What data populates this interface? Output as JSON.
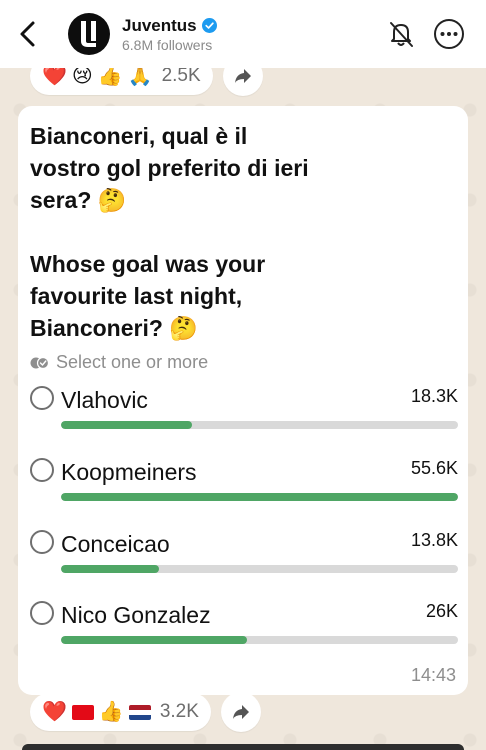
{
  "header": {
    "channel_name": "Juventus",
    "followers": "6.8M followers"
  },
  "reactions_top": {
    "emojis": [
      "❤️",
      "😢",
      "👍",
      "🙏"
    ],
    "count": "2.5K"
  },
  "poll": {
    "question": "Bianconeri, qual è il\nvostro gol preferito di ieri\nsera? 🤔\n\nWhose goal was your\nfavourite last night,\nBianconeri? 🤔",
    "select_hint": "Select one or more",
    "options": [
      {
        "label": "Vlahovic",
        "count": "18.3K",
        "fraction": 0.329
      },
      {
        "label": "Koopmeiners",
        "count": "55.6K",
        "fraction": 1.0
      },
      {
        "label": "Conceicao",
        "count": "13.8K",
        "fraction": 0.248
      },
      {
        "label": "Nico Gonzalez",
        "count": "26K",
        "fraction": 0.468
      }
    ],
    "timestamp": "14:43"
  },
  "reactions_bottom": {
    "emojis": [
      "❤️",
      "🇹🇷",
      "👍",
      "🇳🇱"
    ],
    "count": "3.2K"
  },
  "colors": {
    "bar_fill": "#4fa665",
    "bar_track": "#d9d9d9",
    "verified": "#1d9bf0"
  }
}
